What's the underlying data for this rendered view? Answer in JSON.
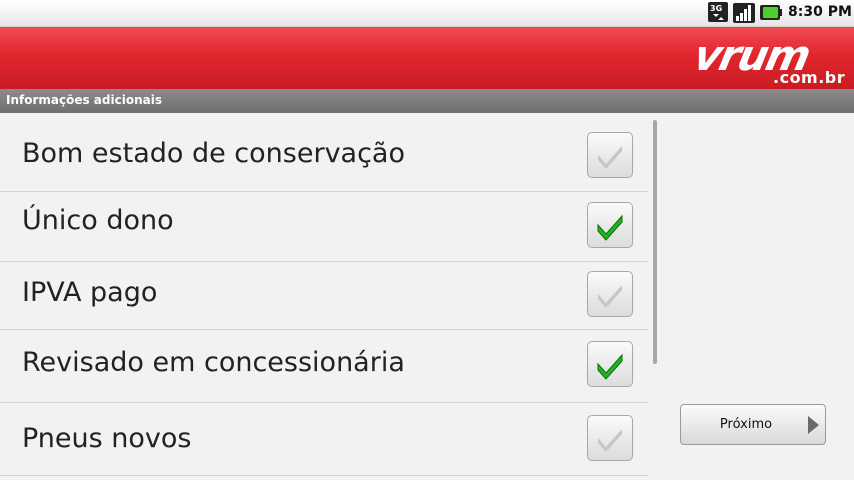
{
  "status_bar": {
    "network_label": "3G",
    "time": "8:30 PM",
    "icons": [
      "3g-icon",
      "signal-icon",
      "battery-icon"
    ]
  },
  "header": {
    "logo_text": "vrum",
    "logo_domain": ".com.br",
    "brand_color": "#e2262e"
  },
  "section": {
    "title": "Informações adicionais"
  },
  "options": [
    {
      "label": "Bom estado de conservação",
      "checked": false
    },
    {
      "label": "Único dono",
      "checked": true
    },
    {
      "label": "IPVA pago",
      "checked": false
    },
    {
      "label": "Revisado em concessionária",
      "checked": true
    },
    {
      "label": "Pneus novos",
      "checked": false
    }
  ],
  "actions": {
    "next_label": "Próximo"
  },
  "colors": {
    "check_on": "#1fb51f",
    "check_off": "#c6c6c6"
  }
}
